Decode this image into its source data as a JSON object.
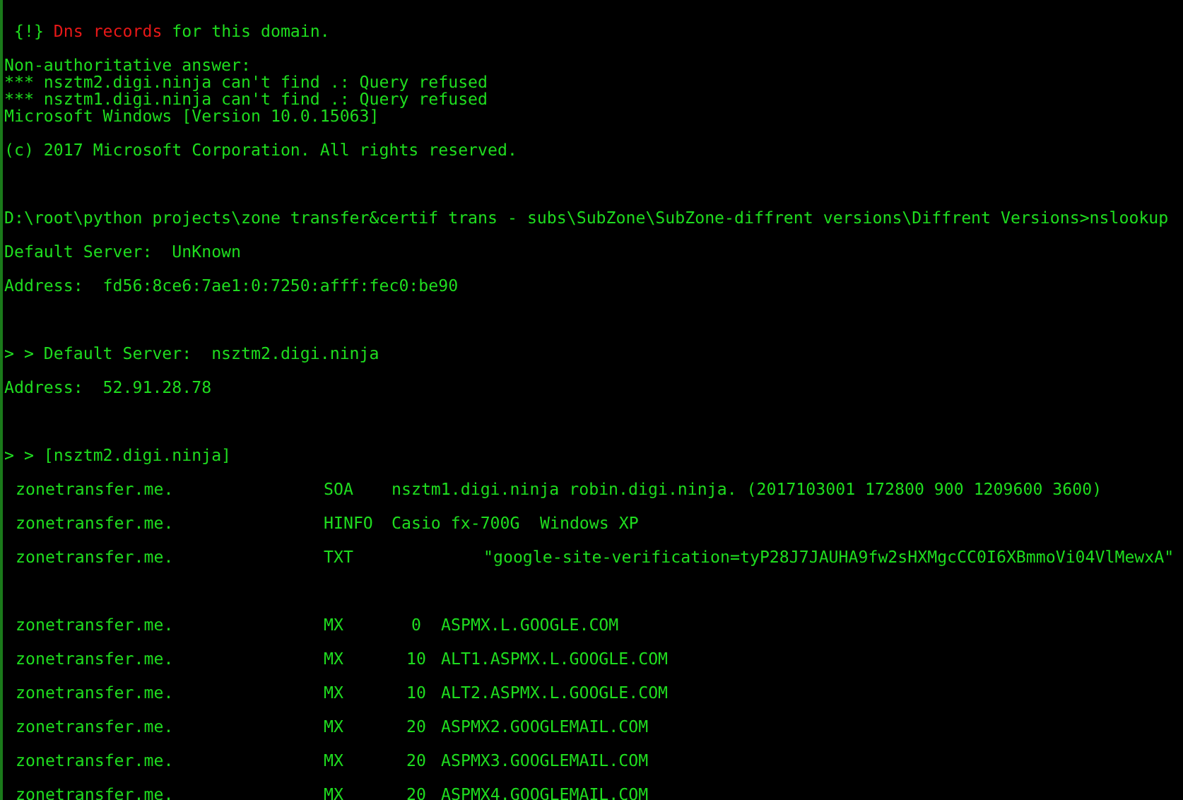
{
  "blocks": [
    {
      "kind": "spaced",
      "lines": [
        {
          "parts": [
            {
              "text": " {!} ",
              "alert": false
            },
            {
              "text": "Dns records",
              "alert": true
            },
            {
              "text": " for this domain.",
              "alert": false
            }
          ]
        }
      ]
    },
    {
      "kind": "tight",
      "lines": [
        {
          "text": "Non-authoritative answer:"
        },
        {
          "text": "*** nsztm2.digi.ninja can't find .: Query refused"
        },
        {
          "text": "*** nsztm1.digi.ninja can't find .: Query refused"
        },
        {
          "text": "Microsoft Windows [Version 10.0.15063]"
        }
      ]
    },
    {
      "kind": "spaced",
      "lines": [
        {
          "text": "(c) 2017 Microsoft Corporation. All rights reserved."
        }
      ]
    },
    {
      "kind": "spaced",
      "lines": [
        {
          "text": "D:\\root\\python projects\\zone transfer&certif trans - subs\\SubZone\\SubZone-diffrent versions\\Diffrent Versions>nslookup"
        },
        {
          "text": "Default Server:  UnKnown"
        },
        {
          "text": "Address:  fd56:8ce6:7ae1:0:7250:afff:fec0:be90"
        }
      ]
    },
    {
      "kind": "spaced",
      "lines": [
        {
          "text": "> > Default Server:  nsztm2.digi.ninja"
        },
        {
          "text": "Address:  52.91.28.78"
        }
      ]
    },
    {
      "kind": "spaced",
      "lines": [
        {
          "text": "> > [nsztm2.digi.ninja]"
        }
      ],
      "records": [
        {
          "kind": "soa",
          "name": "zonetransfer.me.",
          "type": "SOA",
          "fields": [
            "nsztm1.digi.ninja robin.digi.ninja. (2017103001 172800 900 1209600 3600)"
          ]
        },
        {
          "kind": "hinfo",
          "name": "zonetransfer.me.",
          "type": "HINFO",
          "fields": [
            "Casio fx-700G",
            "Windows XP"
          ]
        },
        {
          "kind": "txt",
          "name": "zonetransfer.me.",
          "type": "TXT",
          "fields": [
            "\"google-site-verification=tyP28J7JAUHA9fw2sHXMgcCC0I6XBmmoVi04VlMewxA\""
          ]
        }
      ]
    },
    {
      "kind": "spaced",
      "records": [
        {
          "kind": "mx",
          "name": "zonetransfer.me.",
          "type": "MX",
          "fields": [
            "0",
            "ASPMX.L.GOOGLE.COM"
          ]
        },
        {
          "kind": "mx",
          "name": "zonetransfer.me.",
          "type": "MX",
          "fields": [
            "10",
            "ALT1.ASPMX.L.GOOGLE.COM"
          ]
        },
        {
          "kind": "mx",
          "name": "zonetransfer.me.",
          "type": "MX",
          "fields": [
            "10",
            "ALT2.ASPMX.L.GOOGLE.COM"
          ]
        },
        {
          "kind": "mx",
          "name": "zonetransfer.me.",
          "type": "MX",
          "fields": [
            "20",
            "ASPMX2.GOOGLEMAIL.COM"
          ]
        },
        {
          "kind": "mx",
          "name": "zonetransfer.me.",
          "type": "MX",
          "fields": [
            "20",
            "ASPMX3.GOOGLEMAIL.COM"
          ]
        },
        {
          "kind": "mx",
          "name": "zonetransfer.me.",
          "type": "MX",
          "fields": [
            "20",
            "ASPMX4.GOOGLEMAIL.COM"
          ]
        }
      ]
    }
  ]
}
